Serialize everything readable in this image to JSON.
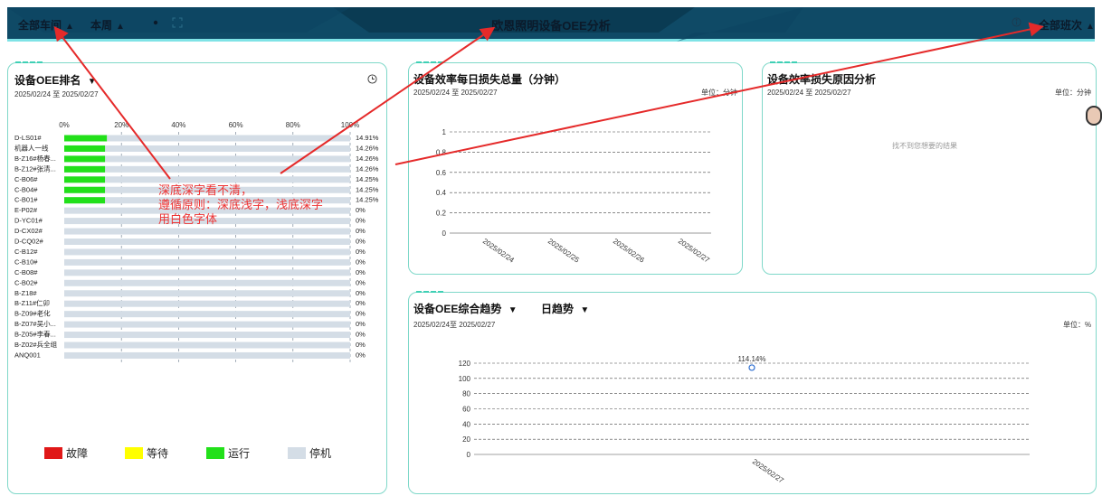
{
  "header": {
    "workshop_label": "全部车间",
    "week_label": "本周",
    "title": "欧恩照明设备OEE分析",
    "shift_label": "全部班次",
    "caret": "▲",
    "info_icon": "info-icon",
    "settings_icon": "gear-icon",
    "fullscreen_icon": "fullscreen-icon"
  },
  "ranking": {
    "title": "设备OEE排名",
    "title_caret": "▼",
    "date_range": "2025/02/24 至 2025/02/27",
    "clock_icon": "clock-icon",
    "axis_ticks": [
      "0%",
      "20%",
      "40%",
      "60%",
      "80%",
      "100%"
    ],
    "rows": [
      {
        "name": "D-LS01#",
        "pct_label": "14.91%",
        "running": 0.1491
      },
      {
        "name": "机器人一线",
        "pct_label": "14.26%",
        "running": 0.1426
      },
      {
        "name": "B-Z16#杨春...",
        "pct_label": "14.26%",
        "running": 0.1426
      },
      {
        "name": "B-Z12#张清...",
        "pct_label": "14.26%",
        "running": 0.1426
      },
      {
        "name": "C-B06#",
        "pct_label": "14.25%",
        "running": 0.1425
      },
      {
        "name": "C-B04#",
        "pct_label": "14.25%",
        "running": 0.1425
      },
      {
        "name": "C-B01#",
        "pct_label": "14.25%",
        "running": 0.1425
      },
      {
        "name": "E-P02#",
        "pct_label": "0%",
        "running": 0
      },
      {
        "name": "D-YC01#",
        "pct_label": "0%",
        "running": 0
      },
      {
        "name": "D-CX02#",
        "pct_label": "0%",
        "running": 0
      },
      {
        "name": "D-CQ02#",
        "pct_label": "0%",
        "running": 0
      },
      {
        "name": "C-B12#",
        "pct_label": "0%",
        "running": 0
      },
      {
        "name": "C-B10#",
        "pct_label": "0%",
        "running": 0
      },
      {
        "name": "C-B08#",
        "pct_label": "0%",
        "running": 0
      },
      {
        "name": "C-B02#",
        "pct_label": "0%",
        "running": 0
      },
      {
        "name": "B-Z18#",
        "pct_label": "0%",
        "running": 0
      },
      {
        "name": "B-Z11#仁卯",
        "pct_label": "0%",
        "running": 0
      },
      {
        "name": "B-Z09#老化",
        "pct_label": "0%",
        "running": 0
      },
      {
        "name": "B-Z07#吴小...",
        "pct_label": "0%",
        "running": 0
      },
      {
        "name": "B-Z05#李春...",
        "pct_label": "0%",
        "running": 0
      },
      {
        "name": "B-Z02#兵全组",
        "pct_label": "0%",
        "running": 0
      },
      {
        "name": "ANQ001",
        "pct_label": "0%",
        "running": 0
      }
    ],
    "legend": [
      {
        "label": "故障",
        "color": "#e01818"
      },
      {
        "label": "等待",
        "color": "#ffff00"
      },
      {
        "label": "运行",
        "color": "#22e01a"
      },
      {
        "label": "停机",
        "color": "#d4dde6"
      }
    ]
  },
  "daily_loss": {
    "title": "设备效率每日损失总量（分钟）",
    "date_range": "2025/02/24 至 2025/02/27",
    "unit": "单位：分钟",
    "y_ticks": [
      "1",
      "0.8",
      "0.6",
      "0.4",
      "0.2",
      "0"
    ],
    "x_ticks": [
      "2025/02/24",
      "2025/02/25",
      "2025/02/26",
      "2025/02/27"
    ]
  },
  "loss_reason": {
    "title": "设备效率损失原因分析",
    "date_range": "2025/02/24 至 2025/02/27",
    "unit": "单位：分钟",
    "empty_message": "找不到您想要的结果"
  },
  "oee_trend": {
    "title": "设备OEE综合趋势",
    "title_caret": "▼",
    "mode_label": "日趋势",
    "mode_caret": "▼",
    "date_range": "2025/02/24至 2025/02/27",
    "unit": "单位：%",
    "y_ticks": [
      "120",
      "100",
      "80",
      "60",
      "40",
      "20",
      "0"
    ],
    "x_ticks": [
      "2025/02/27"
    ],
    "point_label": "114.14%"
  },
  "annotation": {
    "line1": "深底深字看不清，",
    "line2": "遵循原则：深底浅字，浅底深字",
    "line3": "用白色字体"
  },
  "chart_data": [
    {
      "type": "bar",
      "title": "设备OEE排名",
      "stacked": true,
      "orientation": "horizontal",
      "categories": [
        "D-LS01#",
        "机器人一线",
        "B-Z16#杨春...",
        "B-Z12#张清...",
        "C-B06#",
        "C-B04#",
        "C-B01#",
        "E-P02#",
        "D-YC01#",
        "D-CX02#",
        "D-CQ02#",
        "C-B12#",
        "C-B10#",
        "C-B08#",
        "C-B02#",
        "B-Z18#",
        "B-Z11#仁卯",
        "B-Z09#老化",
        "B-Z07#吴小...",
        "B-Z05#李春...",
        "B-Z02#兵全组",
        "ANQ001"
      ],
      "series": [
        {
          "name": "运行",
          "values": [
            14.91,
            14.26,
            14.26,
            14.26,
            14.25,
            14.25,
            14.25,
            0,
            0,
            0,
            0,
            0,
            0,
            0,
            0,
            0,
            0,
            0,
            0,
            0,
            0,
            0
          ]
        },
        {
          "name": "停机",
          "values": [
            85.09,
            85.74,
            85.74,
            85.74,
            85.75,
            85.75,
            85.75,
            100,
            100,
            100,
            100,
            100,
            100,
            100,
            100,
            100,
            100,
            100,
            100,
            100,
            100,
            100
          ]
        }
      ],
      "xlim": [
        0,
        100
      ],
      "legend_position": "bottom"
    },
    {
      "type": "line",
      "title": "设备效率每日损失总量（分钟）",
      "x": [
        "2025/02/24",
        "2025/02/25",
        "2025/02/26",
        "2025/02/27"
      ],
      "series": [],
      "ylim": [
        0,
        1
      ],
      "grid": true
    },
    {
      "type": "scatter",
      "title": "设备OEE综合趋势",
      "x": [
        "2025/02/27"
      ],
      "series": [
        {
          "values": [
            114.14
          ]
        }
      ],
      "ylim": [
        0,
        120
      ],
      "grid": true
    }
  ]
}
